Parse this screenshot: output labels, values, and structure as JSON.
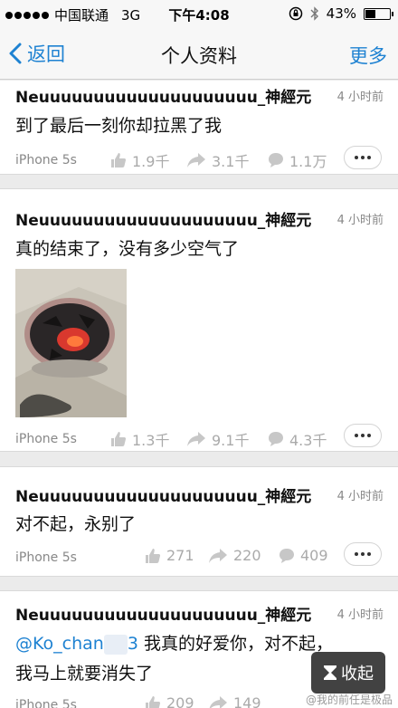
{
  "status_bar": {
    "carrier": "中国联通",
    "network": "3G",
    "time": "下午4:08",
    "battery": "43%",
    "battery_level": 0.43
  },
  "nav": {
    "back_label": "返回",
    "title": "个人资料",
    "more_label": "更多"
  },
  "posts": [
    {
      "author": "Neuuuuuuuuuuuuuuuuuuuu_神經元",
      "time": "4 小时前",
      "text": "到了最后一刻你却拉黑了我",
      "device": "iPhone 5s",
      "likes": "1.9千",
      "reposts": "3.1千",
      "comments": "1.1万"
    },
    {
      "author": "Neuuuuuuuuuuuuuuuuuuuu_神經元",
      "time": "4 小时前",
      "text": "真的结束了，没有多少空气了",
      "device": "iPhone 5s",
      "likes": "1.3千",
      "reposts": "9.1千",
      "comments": "4.3千"
    },
    {
      "author": "Neuuuuuuuuuuuuuuuuuuuu_神經元",
      "time": "4 小时前",
      "text": "对不起，永别了",
      "device": "iPhone 5s",
      "likes": "271",
      "reposts": "220",
      "comments": "409"
    },
    {
      "author": "Neuuuuuuuuuuuuuuuuuuuu_神經元",
      "time": "4 小时前",
      "mention": "@Ko_chan",
      "mention_tail": "3",
      "text_line1": " 我真的好爱你，对不起，",
      "text_line2": "我马上就要消失了",
      "device": "iPhone 5s",
      "likes": "209",
      "reposts": "149",
      "comments": ""
    }
  ],
  "collapse_label": "收起",
  "watermark": "@我的前任是极品"
}
